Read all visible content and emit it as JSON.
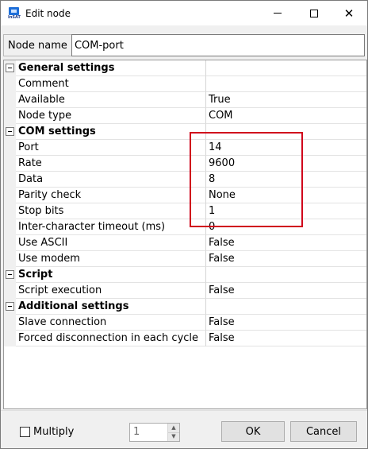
{
  "window": {
    "title": "Edit node",
    "icon_text": "InSAT"
  },
  "node_name": {
    "label": "Node name",
    "value": "COM-port"
  },
  "grid": {
    "categories": [
      {
        "title": "General settings",
        "rows": [
          {
            "name": "Comment",
            "value": ""
          },
          {
            "name": "Available",
            "value": "True"
          },
          {
            "name": "Node type",
            "value": "COM"
          }
        ]
      },
      {
        "title": "COM settings",
        "rows": [
          {
            "name": "Port",
            "value": "14"
          },
          {
            "name": "Rate",
            "value": "9600"
          },
          {
            "name": "Data",
            "value": "8"
          },
          {
            "name": "Parity check",
            "value": "None"
          },
          {
            "name": "Stop bits",
            "value": "1"
          },
          {
            "name": "Inter-character timeout (ms)",
            "value": "0"
          },
          {
            "name": "Use ASCII",
            "value": "False"
          },
          {
            "name": "Use modem",
            "value": "False"
          }
        ]
      },
      {
        "title": "Script",
        "rows": [
          {
            "name": "Script execution",
            "value": "False"
          }
        ]
      },
      {
        "title": "Additional settings",
        "rows": [
          {
            "name": "Slave connection",
            "value": "False"
          },
          {
            "name": "Forced disconnection in each cycle",
            "value": "False"
          }
        ]
      }
    ]
  },
  "bottom": {
    "multiply_label": "Multiply",
    "multiply_checked": false,
    "count_value": "1",
    "ok_label": "OK",
    "cancel_label": "Cancel"
  },
  "colors": {
    "highlight": "#d0021b",
    "window_bg": "#f0f0f0"
  }
}
